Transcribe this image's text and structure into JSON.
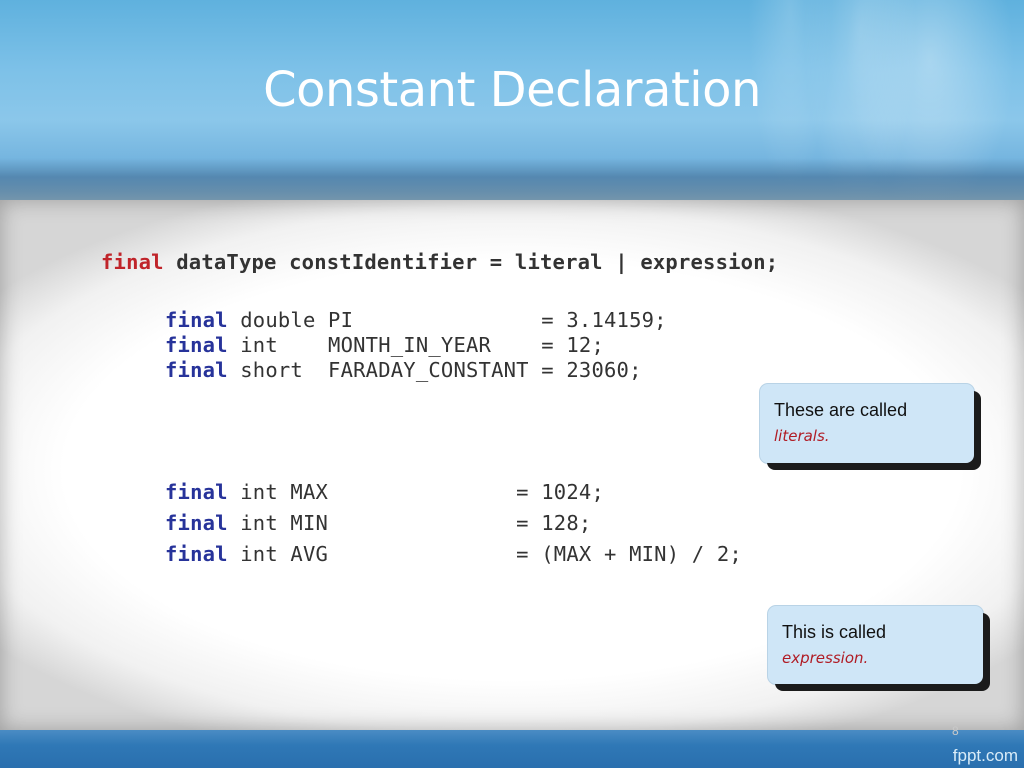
{
  "slide": {
    "title": "Constant Declaration",
    "brand": "fppt.com",
    "slide_number": "8"
  },
  "syntax": {
    "keyword": "final",
    "rest": " dataType constIdentifier = literal | expression;"
  },
  "literal_examples": [
    {
      "keyword": "final",
      "text": " double PI               = 3.14159;"
    },
    {
      "keyword": "final",
      "text": " int    MONTH_IN_YEAR    = 12;"
    },
    {
      "keyword": "final",
      "text": " short  FARADAY_CONSTANT = 23060;"
    }
  ],
  "expression_examples": [
    {
      "keyword": "final",
      "text": " int MAX               = 1024;"
    },
    {
      "keyword": "final",
      "text": " int MIN               = 128;"
    },
    {
      "keyword": "final",
      "text": " int AVG               = (MAX + MIN) / 2;"
    }
  ],
  "callouts": {
    "literals": {
      "line1": "These are called",
      "line2": "literals."
    },
    "expression": {
      "line1": "This is called",
      "line2": "expression."
    }
  },
  "colors": {
    "header": "#7dc1e8",
    "footer": "#2a6fae",
    "keyword_syntax": "#c0242a",
    "keyword_code": "#27339a",
    "callout_bg": "#cfe6f7",
    "callout_emphasis": "#b01c25"
  }
}
